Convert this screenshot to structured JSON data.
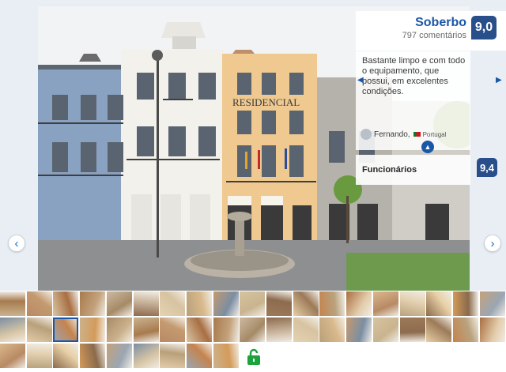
{
  "rating": {
    "word": "Soberbo",
    "count_text": "797 comentários",
    "score": "9,0"
  },
  "review": {
    "text": "Bastante limpo e com todo o equipamento, que possui, em excelentes condições.",
    "reviewer_name": "Fernando,",
    "reviewer_country": "Portugal"
  },
  "subscore": {
    "label": "Funcionários",
    "score": "9,4"
  },
  "photo": {
    "sign_text": "RESIDENCIAL"
  },
  "icons": {
    "prev": "chevron-left-icon",
    "next": "chevron-right-icon",
    "collapse": "chevron-up-icon",
    "lock": "unlock-icon"
  },
  "colors": {
    "brand_blue": "#1a57a6",
    "badge_blue": "#284f8a",
    "lock_green": "#1ca33b"
  },
  "thumbnails": {
    "selected_index": 21,
    "palette": [
      "#c9b48f",
      "#b88a64",
      "#d8c6a6",
      "#a77a4e",
      "#cdb9a2",
      "#8d6b4e",
      "#e4d2b2",
      "#b8a07a",
      "#c49a70",
      "#d7c3a0",
      "#9c7a58",
      "#e8cfa6",
      "#c5844e",
      "#a96e42",
      "#d9b98c",
      "#b9a27d",
      "#8a6a4c",
      "#d49b5a",
      "#c4a27c",
      "#7b8ea3",
      "#e3ccaa",
      "#9aa6b3",
      "#ccb28c",
      "#a58a66"
    ]
  }
}
